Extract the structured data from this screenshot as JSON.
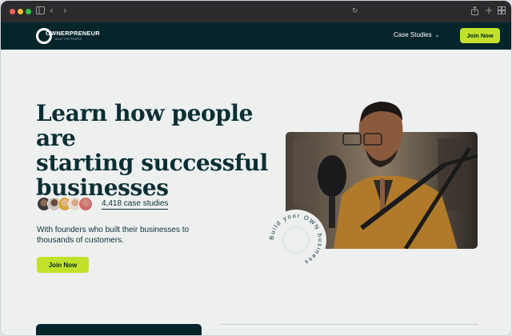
{
  "browser": {
    "controls": [
      "close",
      "minimize",
      "maximize"
    ],
    "icons": [
      "sidebar-icon",
      "back-icon",
      "forward-icon",
      "reload-icon",
      "share-icon",
      "new-tab-icon",
      "tabs-overview-icon"
    ]
  },
  "header": {
    "logo_text": "OWNERPRENEUR",
    "logo_sub": "BUILT FOR PEOPLE",
    "nav_case_studies": "Case Studies",
    "join_label": "Join Now"
  },
  "hero": {
    "title_line1": "Learn how people are",
    "title_line2_regular": "starting ",
    "title_line2_bold": "successful",
    "title_line3_bold": "businesses",
    "case_studies_link": "4,418 case studies",
    "subtitle": "With founders who built their businesses to thousands of customers.",
    "join_label": "Join Now",
    "badge_text": "Build your OWN business"
  },
  "colors": {
    "brand_dark": "#05252b",
    "accent_lime": "#c2e12a",
    "page_bg": "#eef0f0"
  }
}
